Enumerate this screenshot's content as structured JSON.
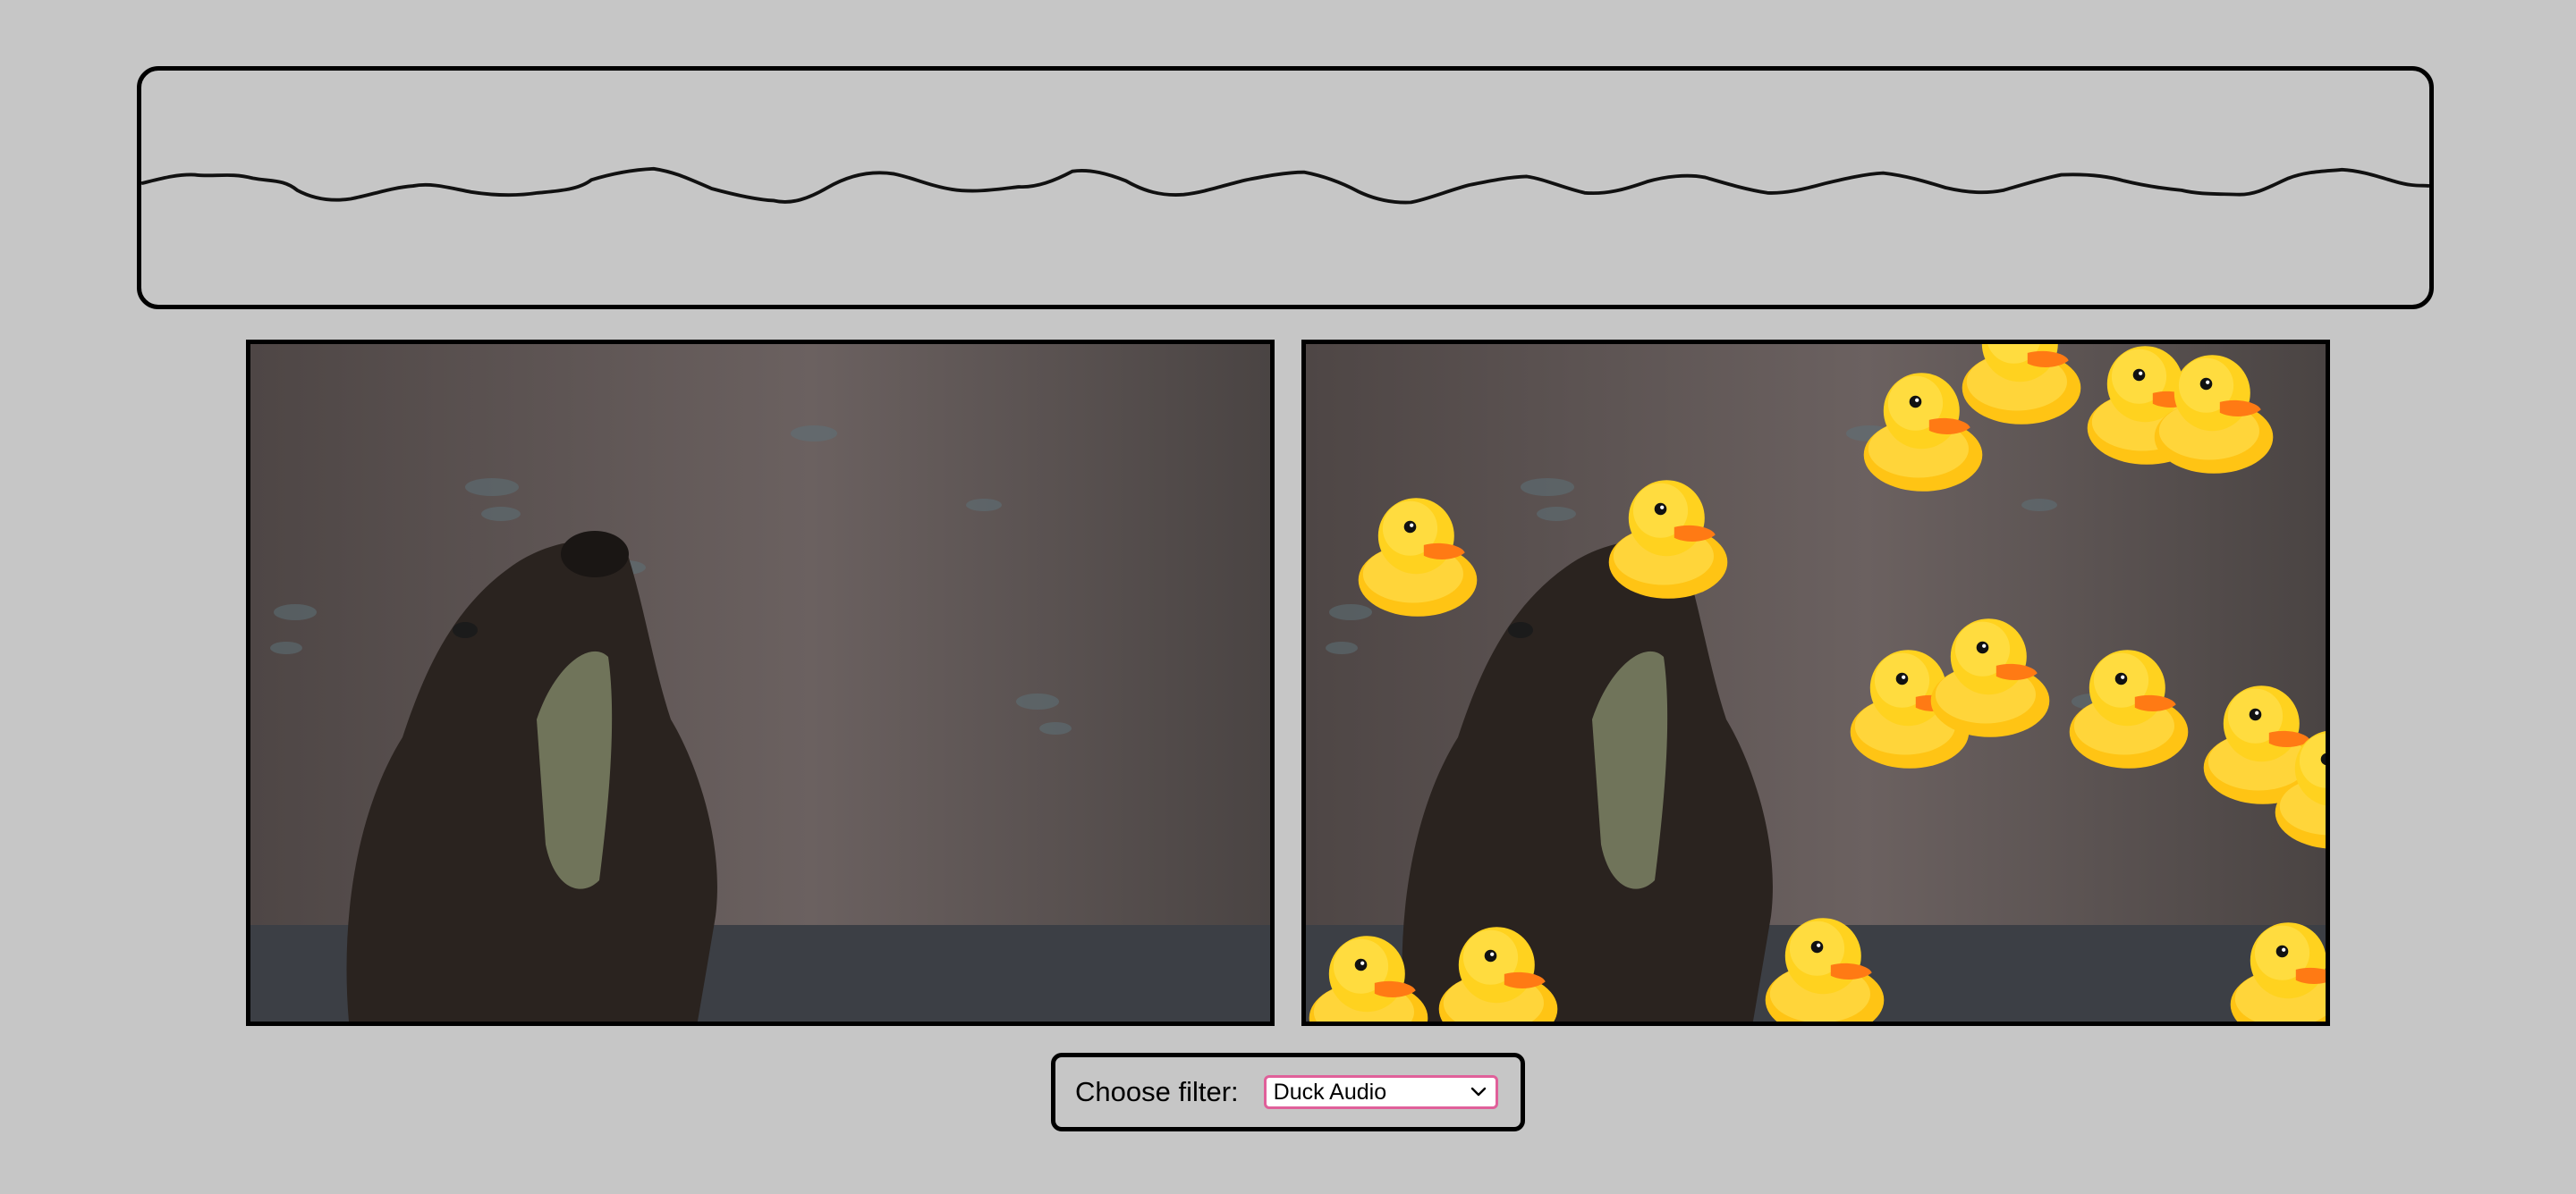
{
  "waveform": {
    "label": ""
  },
  "videos": {
    "original_label": "",
    "filtered_label": ""
  },
  "filter": {
    "label": "Choose filter:",
    "selected": "Duck Audio"
  },
  "colors": {
    "background": "#c6c6c6",
    "border": "#000000",
    "select_focus": "#e0609a",
    "duck_body": "#ffd21f",
    "duck_beak": "#ff7a14"
  },
  "icons": {
    "select_arrow": "chevron-down-icon",
    "overlay_sprite": "rubber-duck"
  }
}
